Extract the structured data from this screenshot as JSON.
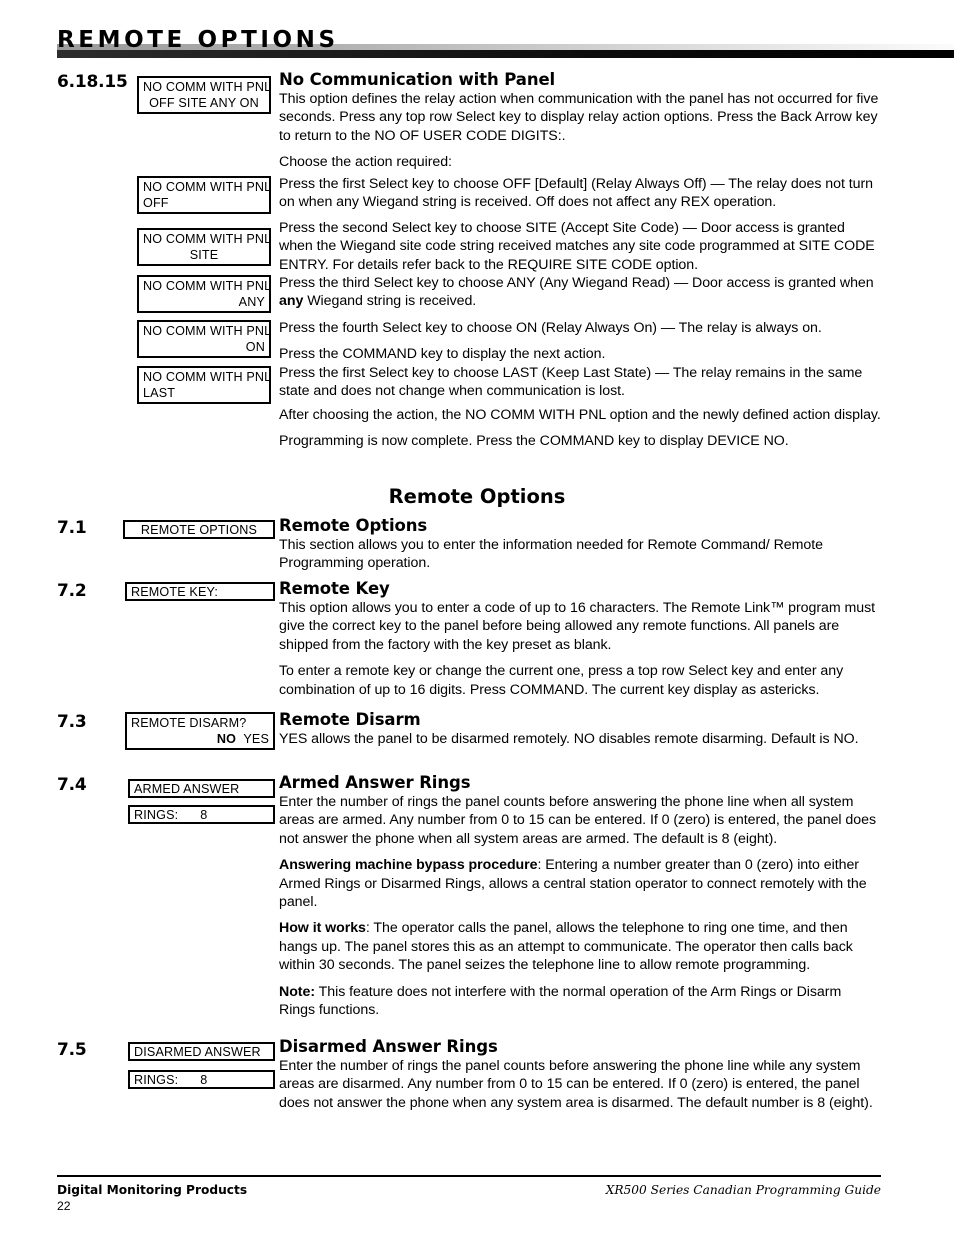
{
  "header": {
    "title": "REMOTE OPTIONS"
  },
  "sections": [
    {
      "number": "6.18.15",
      "heading": "No Communication with Panel",
      "lcd": {
        "line1": "NO COMM WITH PNL",
        "line2": "OFF  SITE  ANY  ON"
      },
      "paragraphs": [
        "This option defines the relay action when communication with the panel has not occurred for five seconds.  Press any top row Select key to display relay action options. Press the Back Arrow key to return to the NO OF USER CODE DIGITS:.",
        "Choose the action required:"
      ]
    },
    {
      "number": "7.1",
      "heading": "Remote Options",
      "lcd": {
        "line1": "REMOTE OPTIONS"
      },
      "paragraphs": [
        "This section allows you to enter the information needed for Remote Command/ Remote Programming operation."
      ]
    },
    {
      "number": "7.2",
      "heading": "Remote Key",
      "lcd": {
        "line1": "REMOTE  KEY:"
      },
      "paragraphs": [
        "This option allows you to enter a code of up to 16 characters. The Remote Link™ program must give the correct key to the panel before being allowed any remote functions.  All panels are shipped from the factory with the key preset as blank.",
        "To enter a remote key or change the current one, press a top row Select key and enter any combination of up to 16 digits.  Press COMMAND.  The current key display as astericks."
      ]
    },
    {
      "number": "7.3",
      "heading": "Remote Disarm",
      "lcd": {
        "line1": "REMOTE DISARM?",
        "line2_bold": "NO",
        "line2_rest": "YES"
      },
      "paragraphs": [
        "YES allows the panel to be disarmed remotely.  NO disables remote disarming.  Default is NO."
      ]
    },
    {
      "number": "7.4",
      "heading": "Armed Answer Rings",
      "lcd": {
        "line1": "ARMED ANSWER",
        "line2_label": "RINGS:",
        "line2_value": "8"
      },
      "paragraphs": [
        "Enter the number of rings the panel counts before answering the phone line when all system areas are armed.  Any number from 0 to 15 can be entered.  If 0 (zero) is entered, the panel does not answer the phone when all system areas are armed.  The default is 8 (eight).",
        "Answering machine bypass procedure: Entering a number greater than 0 (zero) into either Armed Rings or Disarmed Rings, allows a central station operator to connect remotely with the panel.",
        "How it works: The operator calls the panel, allows the telephone to ring one time, and then hangs up.  The panel stores this as an attempt to communicate.  The operator then calls back within 30 seconds.  The panel seizes the telephone line to allow remote programming.",
        "Note: This feature does not interfere with the normal operation of the Arm Rings or Disarm Rings functions."
      ]
    },
    {
      "number": "7.5",
      "heading": "Disarmed Answer Rings",
      "lcd": {
        "line1": "DISARMED ANSWER",
        "line2_label": "RINGS:",
        "line2_value": "8"
      },
      "paragraphs": [
        "Enter the number of rings the panel counts before answering the phone line while any system areas are disarmed.  Any number from 0 to 15 can be entered.  If 0 (zero) is entered, the panel does not answer the phone when any system area is disarmed.  The default number is 8 (eight)."
      ]
    }
  ],
  "relay_options": [
    {
      "lcd_line1": "NO COMM WITH PNL",
      "lcd_line2": "OFF",
      "lcd_align": "l",
      "text": "Press the first Select key to choose OFF [Default] (Relay Always Off) — The relay does not turn on when any Wiegand string is received.  Off does not affect any REX operation."
    },
    {
      "lcd_line1": "NO COMM WITH PNL",
      "lcd_line2": "SITE",
      "lcd_align": "c",
      "text": "Press the second Select key to choose SITE (Accept Site Code) — Door access is granted when the Wiegand site code string received matches any site code programmed at SITE CODE ENTRY.  For details refer back to the REQUIRE SITE CODE option."
    },
    {
      "lcd_line1": "NO COMM WITH PNL",
      "lcd_line2": "ANY",
      "lcd_align": "r",
      "text_pre": "Press the third Select key to choose ANY (Any Wiegand Read) — Door access is granted when ",
      "text_bold": "any",
      "text_post": " Wiegand string is received."
    },
    {
      "lcd_line1": "NO COMM WITH PNL",
      "lcd_line2": "ON",
      "lcd_align": "r",
      "text": "Press the fourth Select key to choose ON (Relay Always On) — The relay is always on.",
      "text2": "Press the COMMAND key to display the next action."
    },
    {
      "lcd_line1": "NO COMM WITH PNL",
      "lcd_line2": "LAST",
      "lcd_align": "l",
      "text": "Press the first Select key to choose LAST (Keep Last State) — The relay remains in the same state and does not change when communication is lost."
    }
  ],
  "closing_paragraphs": [
    "After choosing the action, the NO COMM WITH PNL option and the newly defined action display.",
    "Programming is now complete.  Press the COMMAND key to display DEVICE NO."
  ],
  "section_title": "Remote Options",
  "footer": {
    "company": "Digital Monitoring Products",
    "page_number": "22",
    "guide": "XR500 Series Canadian Programming Guide"
  }
}
